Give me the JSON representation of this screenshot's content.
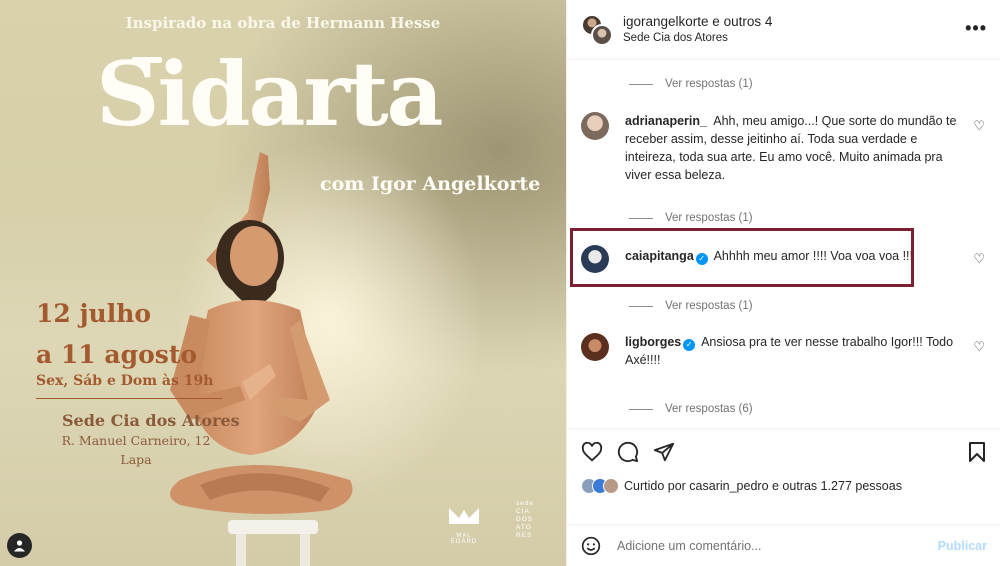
{
  "poster": {
    "subtitle": "Inspirado na obra  de Hermann Hesse",
    "title": "Sidarta",
    "with": "com Igor Angelkorte",
    "date_line1": "12 julho",
    "date_line2": "a 11 agosto",
    "days": "Sex, Sáb e Dom às 19h",
    "venue": "Sede Cia dos Atores",
    "address": "R. Manuel Carneiro, 12",
    "neighborhood": "Lapa",
    "logo1_caption": "MAL ÉGÁRD",
    "logo2_text": "sede CIA DOS ATO RES"
  },
  "header": {
    "user": "igorangelkorte e outros 4",
    "location": "Sede Cia dos Atores",
    "more_icon": "more-horizontal-icon"
  },
  "replies": [
    "Ver respostas (1)",
    "Ver respostas (1)",
    "Ver respostas (1)",
    "Ver respostas (6)"
  ],
  "comments": [
    {
      "user": "adrianaperin_",
      "text": "Ahh, meu amigo...! Que sorte do mundão te receber assim, desse jeitinho aí. Toda sua verdade e inteireza, toda sua arte. Eu amo você. Muito animada pra viver essa beleza."
    },
    {
      "user": "caiapitanga",
      "text": "Ahhhh meu amor !!!! Voa voa voa !!!"
    },
    {
      "user": "ligborges",
      "text": "Ansiosa pra te ver nesse trabalho Igor!!! Todo Axé!!!!"
    }
  ],
  "likes": {
    "text": "Curtido por casarin_pedro e outras 1.277 pessoas"
  },
  "add_comment": {
    "placeholder": "Adicione um comentário...",
    "publish": "Publicar"
  },
  "colors": {
    "highlight": "#7c1f33",
    "verified": "#0095f6",
    "poster_accent": "#a35a2f"
  }
}
